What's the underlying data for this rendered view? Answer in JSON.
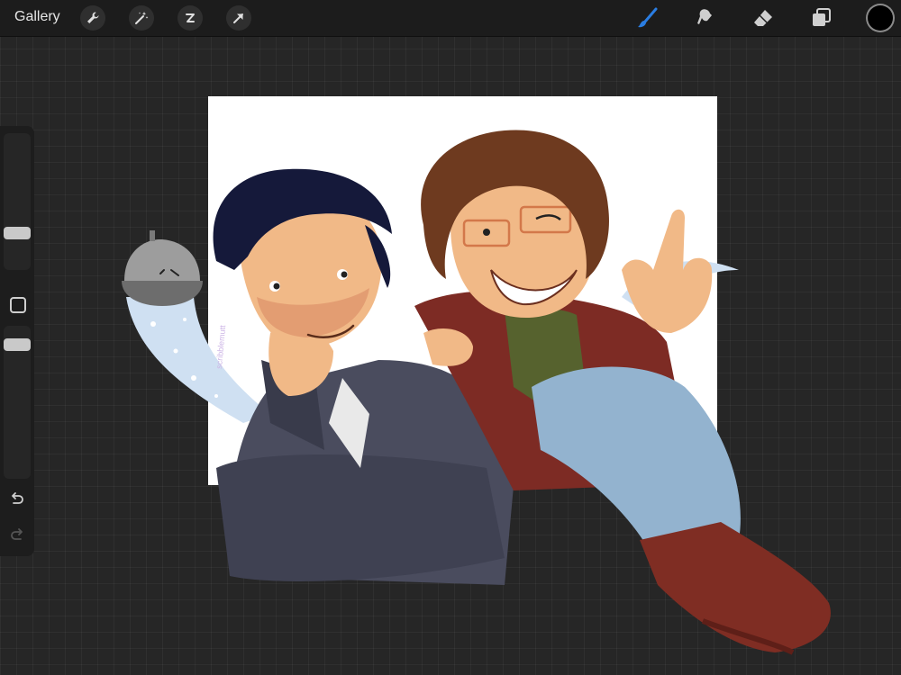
{
  "topbar": {
    "gallery_label": "Gallery",
    "left_tools": [
      "wrench-icon",
      "magic-wand-icon",
      "selection-icon",
      "transform-arrow-icon"
    ],
    "right_tools": [
      "brush-icon",
      "smudge-icon",
      "eraser-icon",
      "layers-icon"
    ],
    "active_tool": "brush-icon",
    "current_color": "#000000",
    "accent_color": "#2a7de1"
  },
  "sidebar": {
    "brush_size": 0.25,
    "opacity": 0.95,
    "controls": [
      "brush-size-slider",
      "modify-button",
      "opacity-slider",
      "undo-icon",
      "redo-icon"
    ]
  },
  "canvas": {
    "background": "#ffffff",
    "artwork": "two cartoon characters illustration",
    "signature": "scribblemutt"
  }
}
